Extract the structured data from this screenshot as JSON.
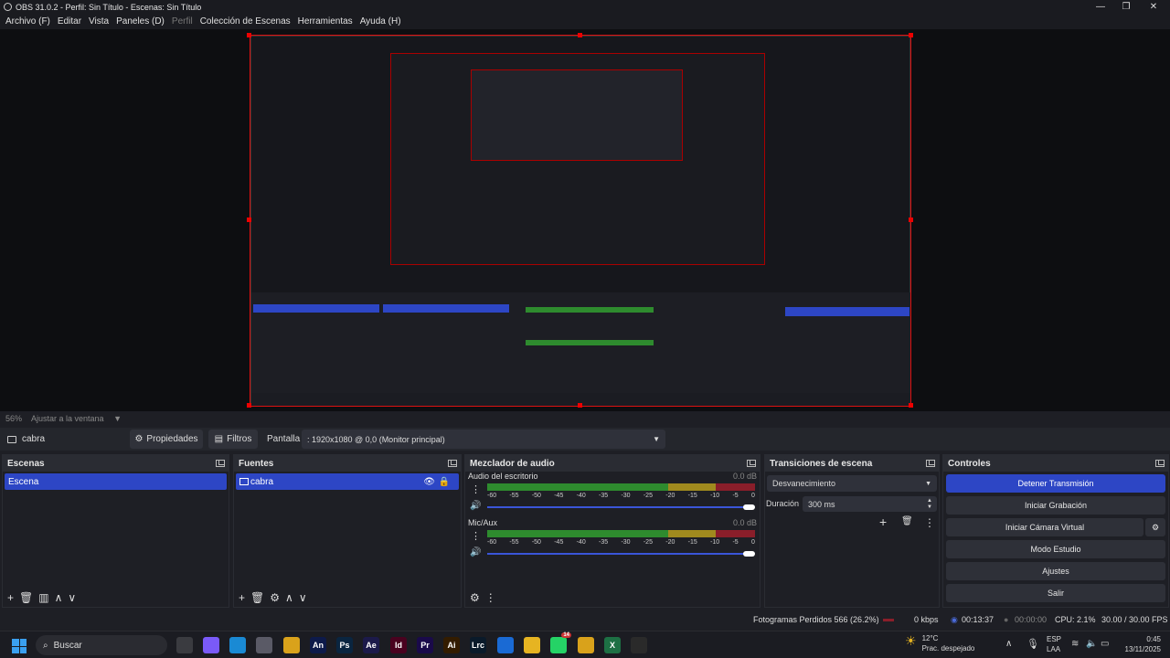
{
  "window": {
    "title": "OBS 31.0.2 - Perfil: Sin Título - Escenas: Sin Título"
  },
  "menu": [
    {
      "label": "Archivo (F)",
      "disabled": false
    },
    {
      "label": "Editar",
      "disabled": false
    },
    {
      "label": "Vista",
      "disabled": false
    },
    {
      "label": "Paneles (D)",
      "disabled": false
    },
    {
      "label": "Perfil",
      "disabled": true
    },
    {
      "label": "Colección de Escenas",
      "disabled": false
    },
    {
      "label": "Herramientas",
      "disabled": false
    },
    {
      "label": "Ayuda (H)",
      "disabled": false
    }
  ],
  "zoom": {
    "percent": "56%",
    "fit_label": "Ajustar a la ventana"
  },
  "source_bar": {
    "source_name": "cabra",
    "properties_label": "Propiedades",
    "filters_label": "Filtros",
    "display_label": "Pantalla",
    "display_value": ": 1920x1080 @ 0,0 (Monitor principal)"
  },
  "scenes": {
    "title": "Escenas",
    "items": [
      "Escena"
    ]
  },
  "sources": {
    "title": "Fuentes",
    "items": [
      "cabra"
    ]
  },
  "mixer": {
    "title": "Mezclador de audio",
    "scale": [
      "-60",
      "-55",
      "-50",
      "-45",
      "-40",
      "-35",
      "-30",
      "-25",
      "-20",
      "-15",
      "-10",
      "-5",
      "0"
    ],
    "channels": [
      {
        "name": "Audio del escritorio",
        "db": "0.0 dB"
      },
      {
        "name": "Mic/Aux",
        "db": "0.0 dB"
      }
    ]
  },
  "transitions": {
    "title": "Transiciones de escena",
    "selected": "Desvanecimiento",
    "duration_label": "Duración",
    "duration_value": "300 ms"
  },
  "controls": {
    "title": "Controles",
    "buttons": [
      "Detener Transmisión",
      "Iniciar Grabación",
      "Iniciar Cámara Virtual",
      "Modo Estudio",
      "Ajustes",
      "Salir"
    ]
  },
  "status": {
    "dropped": "Fotogramas Perdidos 566 (26.2%)",
    "kbps": "0 kbps",
    "stream_time": "00:13:37",
    "rec_time": "00:00:00",
    "cpu": "CPU: 2.1%",
    "fps": "30.00 / 30.00 FPS"
  },
  "taskbar": {
    "search_placeholder": "Buscar",
    "apps": [
      {
        "name": "task-view",
        "label": "",
        "color": "#3a3b40"
      },
      {
        "name": "copilot",
        "label": "",
        "color": "#7a5af8"
      },
      {
        "name": "edge",
        "label": "",
        "color": "#1a8ad4"
      },
      {
        "name": "store",
        "label": "",
        "color": "#5a5a66"
      },
      {
        "name": "chrome",
        "label": "",
        "color": "#d9a21b"
      },
      {
        "name": "animate",
        "label": "An",
        "color": "#0d1a4a"
      },
      {
        "name": "photoshop",
        "label": "Ps",
        "color": "#0a2540"
      },
      {
        "name": "after-effects",
        "label": "Ae",
        "color": "#1c1a4a"
      },
      {
        "name": "indesign",
        "label": "Id",
        "color": "#49021f"
      },
      {
        "name": "premiere",
        "label": "Pr",
        "color": "#1a0a4a"
      },
      {
        "name": "illustrator",
        "label": "Ai",
        "color": "#331c00"
      },
      {
        "name": "lightroom-classic",
        "label": "Lrc",
        "color": "#0a1a2a"
      },
      {
        "name": "mail",
        "label": "",
        "color": "#1a6ad4"
      },
      {
        "name": "explorer",
        "label": "",
        "color": "#e6b422"
      },
      {
        "name": "whatsapp",
        "label": "",
        "color": "#25d366"
      },
      {
        "name": "chrome2",
        "label": "",
        "color": "#d9a21b"
      },
      {
        "name": "excel",
        "label": "X",
        "color": "#1d7044"
      },
      {
        "name": "obs",
        "label": "",
        "color": "#2a2a2a"
      }
    ],
    "weather_temp": "12°C",
    "weather_desc": "Prac. despejado",
    "lang_1": "ESP",
    "lang_2": "LAA",
    "time": "0:45",
    "date": "13/11/2025",
    "whatsapp_badge": "14"
  },
  "colors": {
    "accent": "#2d46c5",
    "meter_green": "#2e8b2e",
    "meter_yellow": "#a08a1e",
    "meter_red": "#8a1e2a"
  }
}
